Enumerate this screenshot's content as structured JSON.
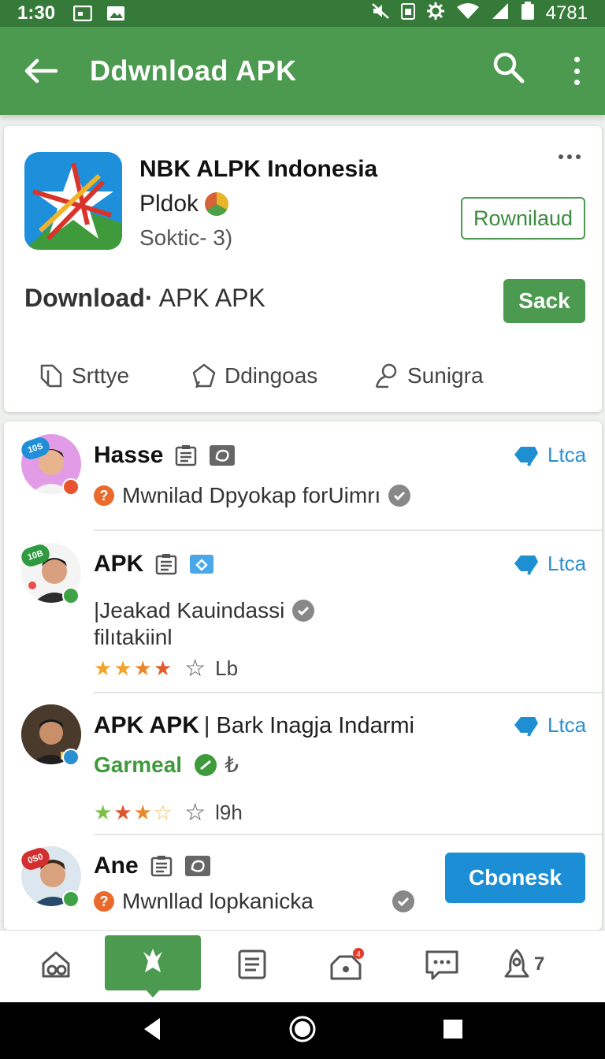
{
  "status_bar": {
    "time": "1:30",
    "right_text": "4781"
  },
  "app_bar": {
    "title": "Ddwnload APK",
    "back_icon": "arrow-left-icon",
    "search_icon": "search-icon",
    "menu_icon": "more-vertical-icon"
  },
  "app_card": {
    "name": "NBK ALPK Indonesia",
    "developer": "Pldok",
    "subtitle": "Soktic- 3)",
    "outline_button": "Rownilaud",
    "section_bold": "Download·",
    "section_rest": " APK APK",
    "solid_button": "Sack",
    "tabs": [
      {
        "label": "Srttye",
        "icon": "tag-icon"
      },
      {
        "label": "Ddingoas",
        "icon": "pentagon-icon"
      },
      {
        "label": "Sunigra",
        "icon": "user-icon"
      }
    ]
  },
  "list": [
    {
      "name": "Hasse",
      "meta": "Mwnilad Dpyokap forUimrı",
      "action": "Ltca",
      "avatar_tag": "10S",
      "tag_color": "#1f8fd8",
      "badge_color": "#e8532f"
    },
    {
      "name": "APK",
      "meta_line1": "|Jeakad Kauindassi",
      "meta_line2": "filıtakiinl",
      "rating": 3.5,
      "rating_count": "Lb",
      "action": "Ltca",
      "avatar_tag": "10B",
      "tag_color": "#2f9a3f",
      "badge_color": "#3fa245"
    },
    {
      "name": "APK APK",
      "name_extra": "| Bark Inagja Indarmi",
      "meta": "Garmeal",
      "meta_suffix": "₺",
      "rating": 3,
      "rating_count": "l9h",
      "action": "Ltca",
      "badge_color": "#2b8fd1"
    },
    {
      "name": "Ane",
      "meta": "Mwnllad lopkanicka",
      "avatar_tag": "0S0",
      "tag_color": "#d42f2f",
      "badge_color": "#3fa245",
      "button": "Cbonesk"
    }
  ],
  "bottom_nav": {
    "items": [
      "home-icon",
      "app-store-icon",
      "document-icon",
      "notifications-icon",
      "chat-icon",
      "rocket-icon"
    ],
    "active_index": 1,
    "notif_badge": "4",
    "last_count": "7"
  },
  "colors": {
    "primary": "#4c9a4f",
    "status_bar": "#357a38",
    "accent_blue": "#1b8ed6"
  }
}
